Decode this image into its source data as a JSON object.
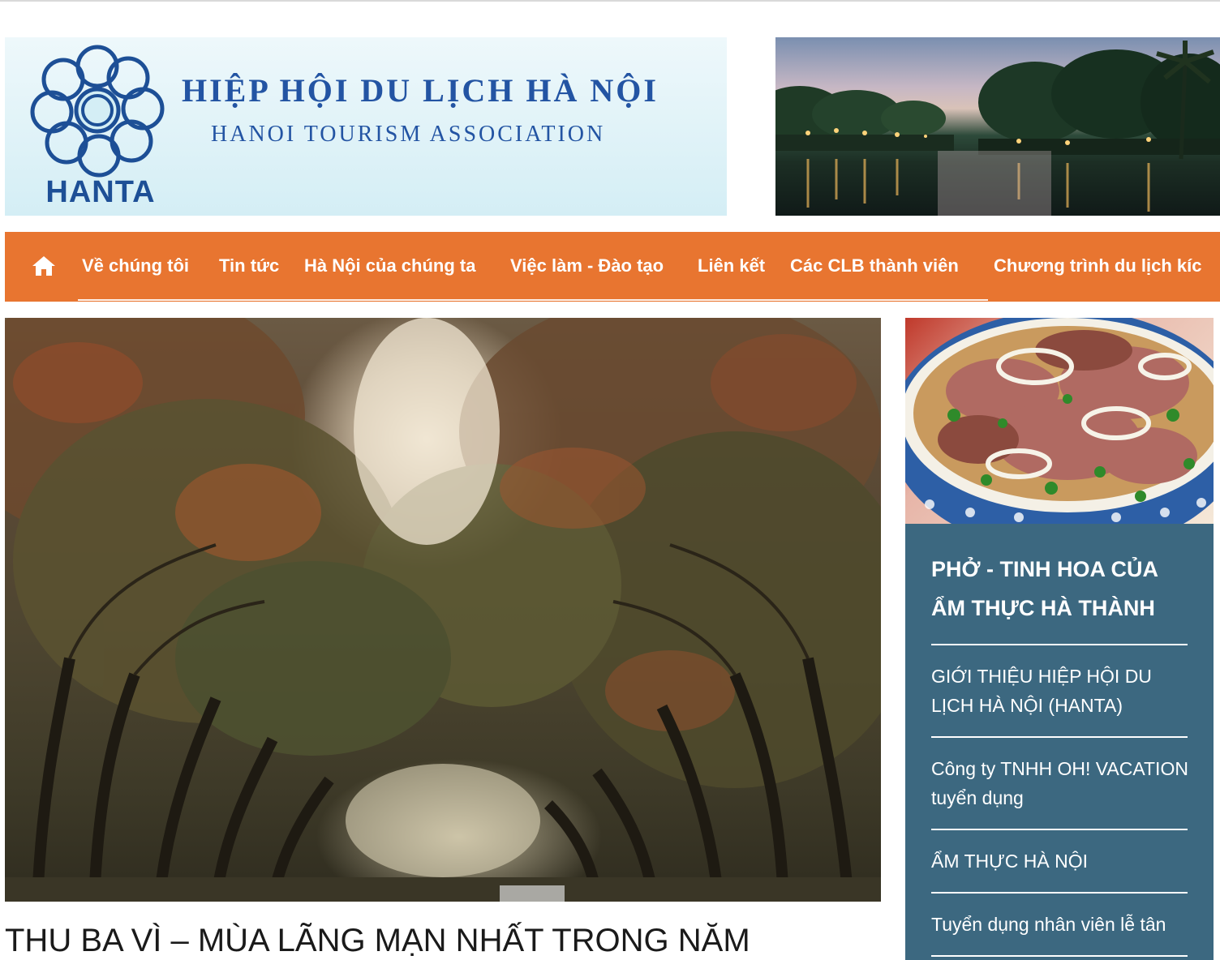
{
  "header": {
    "logo_text": "HANTA",
    "org_name_vi": "HIỆP HỘI DU LỊCH HÀ NỘI",
    "org_name_en": "HANOI TOURISM ASSOCIATION",
    "brand_color": "#2354a3"
  },
  "nav": {
    "background": "#e87530",
    "home_icon": "home-icon",
    "items": [
      {
        "label": "Về chúng tôi"
      },
      {
        "label": "Tin tức"
      },
      {
        "label": "Hà Nội của chúng ta"
      },
      {
        "label": "Việc làm - Đào tạo"
      },
      {
        "label": "Liên kết"
      },
      {
        "label": "Các CLB thành viên"
      },
      {
        "label": "Chương trình du lịch kíc"
      }
    ]
  },
  "article": {
    "title": "THU BA VÌ – MÙA LÃNG MẠN NHẤT TRONG NĂM"
  },
  "sidebar": {
    "background": "#3c6880",
    "featured_title": "PHỞ - TINH HOA CỦA ẨM THỰC HÀ THÀNH",
    "links": [
      {
        "label": "GIỚI THIỆU HIỆP HỘI DU LỊCH HÀ NỘI (HANTA)"
      },
      {
        "label": "Công ty TNHH OH! VACATION tuyển dụng"
      },
      {
        "label": "ẨM THỰC HÀ NỘI"
      },
      {
        "label": "Tuyển dụng nhân viên lễ tân"
      }
    ]
  }
}
